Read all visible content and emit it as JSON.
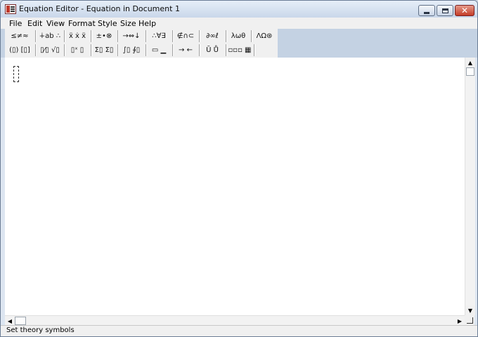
{
  "window": {
    "title": "Equation Editor - Equation in Document 1"
  },
  "menu": [
    "File",
    "Edit",
    "View",
    "Format",
    "Style",
    "Size",
    "Help"
  ],
  "toolbar": {
    "row1": [
      {
        "name": "relational-symbols",
        "label": "≤≠≈"
      },
      {
        "name": "spaces-ellipses",
        "label": "∔ab ∴"
      },
      {
        "name": "embellishments",
        "label": "ẍ ẋ ẍ"
      },
      {
        "name": "operator-symbols",
        "label": "±•⊗"
      },
      {
        "name": "arrow-symbols",
        "label": "→⇔↓"
      },
      {
        "name": "logical-symbols",
        "label": "∴∀∃"
      },
      {
        "name": "set-theory-symbols",
        "label": "∉∩⊂"
      },
      {
        "name": "misc-symbols",
        "label": "∂∞ℓ"
      },
      {
        "name": "greek-lowercase",
        "label": "λωθ"
      },
      {
        "name": "greek-uppercase",
        "label": "ΛΩ⊛"
      }
    ],
    "row2": [
      {
        "name": "fence-templates",
        "label": "(▯) [▯]"
      },
      {
        "name": "fraction-radical-templates",
        "label": "▯⁄▯ √▯"
      },
      {
        "name": "subscript-superscript-templates",
        "label": "▯ˣ ▯"
      },
      {
        "name": "summation-templates",
        "label": "Σ▯ Σ▯"
      },
      {
        "name": "integral-templates",
        "label": "∫▯ ∮▯"
      },
      {
        "name": "underbar-overbar-templates",
        "label": "▭ ▁"
      },
      {
        "name": "labeled-arrow-templates",
        "label": "→ ←"
      },
      {
        "name": "products-set-theory-templates",
        "label": "Ū Ů"
      },
      {
        "name": "matrix-templates",
        "label": "▫▫▫ ▦"
      }
    ]
  },
  "status": {
    "text": "Set theory symbols"
  }
}
